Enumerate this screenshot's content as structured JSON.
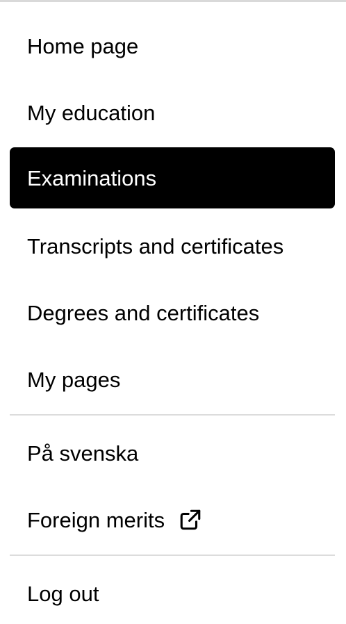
{
  "menu": {
    "items": [
      {
        "label": "Home page",
        "active": false
      },
      {
        "label": "My education",
        "active": false
      },
      {
        "label": "Examinations",
        "active": true
      },
      {
        "label": "Transcripts and certificates",
        "active": false
      },
      {
        "label": "Degrees and certificates",
        "active": false
      },
      {
        "label": "My pages",
        "active": false
      }
    ],
    "secondary": [
      {
        "label": "På svenska"
      },
      {
        "label": "Foreign merits",
        "icon": "external-link-icon"
      }
    ],
    "logout": {
      "label": "Log out"
    }
  },
  "colors": {
    "active_bg": "#000000",
    "active_text": "#ffffff",
    "text": "#000000",
    "divider": "#dcdcdc"
  }
}
